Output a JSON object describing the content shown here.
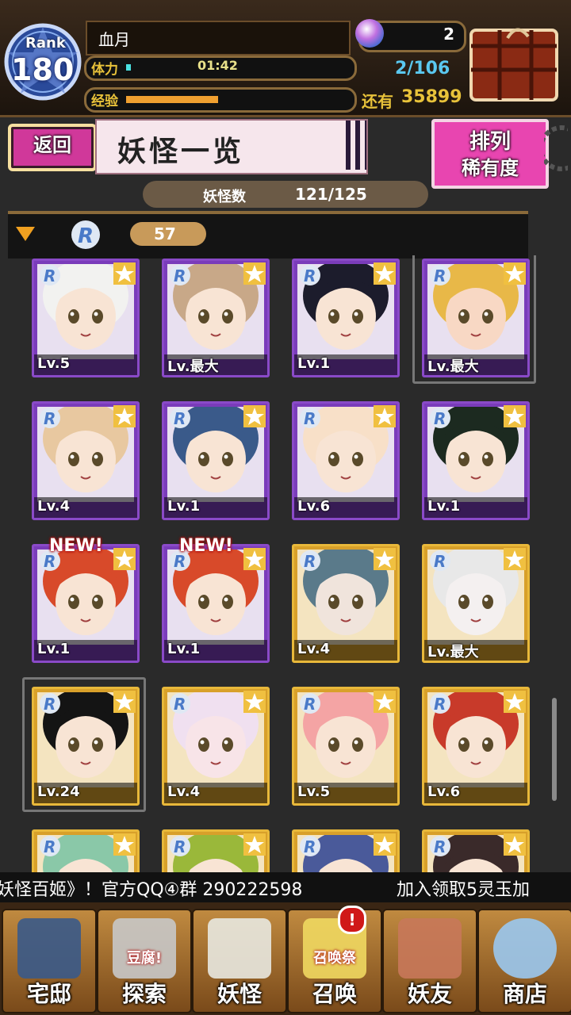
{
  "header": {
    "rank_label": "Rank",
    "rank_value": "180",
    "player_name": "血月",
    "stamina_label": "体力",
    "stamina_timer": "01:42",
    "exp_label": "经验",
    "exp_progress": 0.42,
    "gem_count": "2",
    "capacity": "2/106",
    "remaining_label": "还有",
    "remaining_value": "35899",
    "chest_icon": "treasure-chest-icon"
  },
  "titlebar": {
    "back_label": "返回",
    "title": "妖怪一览",
    "sort_line1": "排列",
    "sort_line2": "稀有度"
  },
  "count": {
    "label": "妖怪数",
    "value": "121/125"
  },
  "rarity_group": {
    "rarity": "R",
    "count": "57"
  },
  "cards": [
    {
      "frame": "purple",
      "level": "Lv.5",
      "new": false,
      "hair": "#f2f2f0",
      "skin": "#f8e4d4"
    },
    {
      "frame": "purple",
      "level": "Lv.最大",
      "new": false,
      "hair": "#c8a888",
      "skin": "#f8e4d4"
    },
    {
      "frame": "purple",
      "level": "Lv.1",
      "new": false,
      "hair": "#1c1c2c",
      "skin": "#f8e4d4"
    },
    {
      "frame": "purple",
      "level": "Lv.最大",
      "new": false,
      "hair": "#e8b848",
      "skin": "#f8d8c4",
      "selected": true
    },
    {
      "frame": "purple",
      "level": "Lv.4",
      "new": false,
      "hair": "#e8c8a0",
      "skin": "#f8e4d4"
    },
    {
      "frame": "purple",
      "level": "Lv.1",
      "new": false,
      "hair": "#3a5a8a",
      "skin": "#f8e4d4"
    },
    {
      "frame": "purple",
      "level": "Lv.6",
      "new": false,
      "hair": "#f8e0c8",
      "skin": "#f8e4d4"
    },
    {
      "frame": "purple",
      "level": "Lv.1",
      "new": false,
      "hair": "#1c2a20",
      "skin": "#f8e4d4"
    },
    {
      "frame": "purple",
      "level": "Lv.1",
      "new": true,
      "hair": "#d84a2a",
      "skin": "#f8e4d4"
    },
    {
      "frame": "purple",
      "level": "Lv.1",
      "new": true,
      "hair": "#d84a2a",
      "skin": "#f8e4d4"
    },
    {
      "frame": "gold",
      "level": "Lv.4",
      "new": false,
      "hair": "#5a7a8a",
      "skin": "#f0e4dc"
    },
    {
      "frame": "gold",
      "level": "Lv.最大",
      "new": false,
      "hair": "#e8e8e8",
      "skin": "#f4f0f0"
    },
    {
      "frame": "gold",
      "level": "Lv.24",
      "new": false,
      "hair": "#141414",
      "skin": "#f8e4d4",
      "selected": true
    },
    {
      "frame": "gold",
      "level": "Lv.4",
      "new": false,
      "hair": "#f0e0f0",
      "skin": "#f8e4e8"
    },
    {
      "frame": "gold",
      "level": "Lv.5",
      "new": false,
      "hair": "#f4a4a4",
      "skin": "#f8e4d4"
    },
    {
      "frame": "gold",
      "level": "Lv.6",
      "new": false,
      "hair": "#c83a2a",
      "skin": "#f8e4d4"
    },
    {
      "frame": "gold",
      "level": "",
      "new": false,
      "hair": "#8ac8a8",
      "skin": "#f8e4d4"
    },
    {
      "frame": "gold",
      "level": "",
      "new": false,
      "hair": "#9ab83a",
      "skin": "#f8e4d4"
    },
    {
      "frame": "gold",
      "level": "",
      "new": false,
      "hair": "#4a5a9a",
      "skin": "#f8e4d4"
    },
    {
      "frame": "gold",
      "level": "",
      "new": false,
      "hair": "#3a2a2a",
      "skin": "#f8e4d4"
    }
  ],
  "new_badge": "NEW!",
  "ticker": {
    "left_text": "妖怪百姬》！官方QQ④群 290222598",
    "right_text": "加入领取5灵玉加"
  },
  "nav": [
    {
      "label": "宅邸",
      "icon": "mansion-icon"
    },
    {
      "label": "探索",
      "icon": "magnifier-icon",
      "tag": "豆腐!"
    },
    {
      "label": "妖怪",
      "icon": "yokai-scroll-icon"
    },
    {
      "label": "召唤",
      "icon": "summon-star-icon",
      "tag": "召唤祭",
      "alert": "!"
    },
    {
      "label": "妖友",
      "icon": "friend-catgirl-icon"
    },
    {
      "label": "商店",
      "icon": "crystal-ball-icon"
    }
  ],
  "colors": {
    "accent_pink": "#e845b0",
    "frame_purple": "#7a3cba",
    "frame_gold": "#d8a02a",
    "label_gold": "#e8c23a"
  }
}
